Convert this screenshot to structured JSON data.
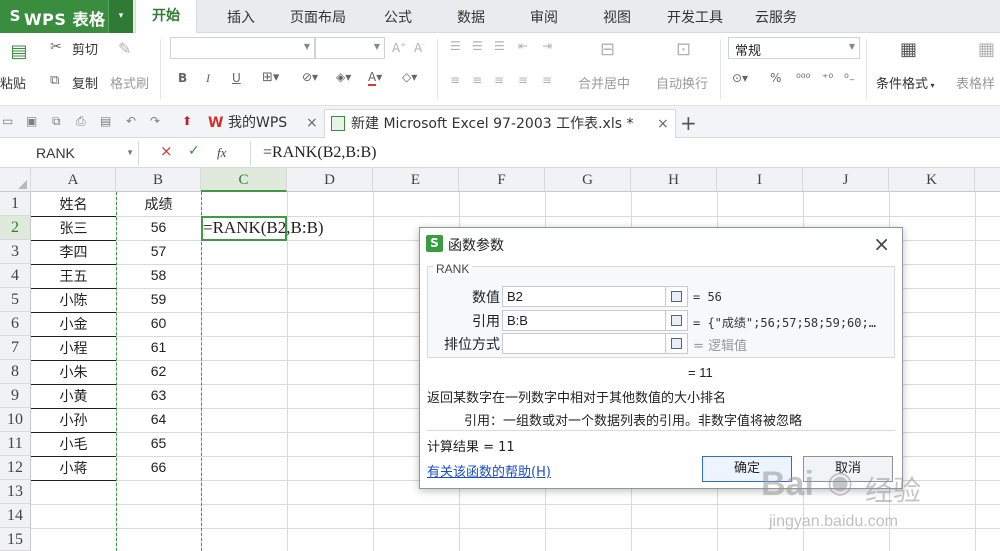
{
  "app": {
    "logo_letter": "S",
    "name": "WPS 表格",
    "menu_caret": "▾"
  },
  "menu_tabs": [
    "开始",
    "插入",
    "页面布局",
    "公式",
    "数据",
    "审阅",
    "视图",
    "开发工具",
    "云服务"
  ],
  "ribbon": {
    "paste": "粘贴",
    "cut": "剪切",
    "copy": "复制",
    "format_painter": "格式刷",
    "merge_center": "合并居中",
    "wrap_text": "自动换行",
    "number_format": "常规",
    "conditional_format": "条件格式",
    "table_style": "表格样"
  },
  "doc_tabs": [
    {
      "label": "我的WPS",
      "close": "×"
    },
    {
      "label": "新建 Microsoft Excel 97-2003 工作表.xls *",
      "close": "×"
    }
  ],
  "new_tab": "+",
  "formula_bar": {
    "name_box": "RANK",
    "cancel": "×",
    "confirm": "✓",
    "fx": "fx",
    "content": "=RANK(B2,B:B)"
  },
  "sheet": {
    "columns": [
      "A",
      "B",
      "C",
      "D",
      "E",
      "F",
      "G",
      "H",
      "I",
      "J",
      "K"
    ],
    "rows": [
      "1",
      "2",
      "3",
      "4",
      "5",
      "6",
      "7",
      "8",
      "9",
      "10",
      "11",
      "12",
      "13",
      "14",
      "15"
    ],
    "headers": {
      "name": "姓名",
      "score": "成绩"
    },
    "records": [
      {
        "name": "张三",
        "score": "56"
      },
      {
        "name": "李四",
        "score": "57"
      },
      {
        "name": "王五",
        "score": "58"
      },
      {
        "name": "小陈",
        "score": "59"
      },
      {
        "name": "小金",
        "score": "60"
      },
      {
        "name": "小程",
        "score": "61"
      },
      {
        "name": "小朱",
        "score": "62"
      },
      {
        "name": "小黄",
        "score": "63"
      },
      {
        "name": "小孙",
        "score": "64"
      },
      {
        "name": "小毛",
        "score": "65"
      },
      {
        "name": "小蒋",
        "score": "66"
      }
    ],
    "active_cell_text": "=RANK(B2,B:B)"
  },
  "dialog": {
    "icon": "S",
    "title": "函数参数",
    "close": "×",
    "function_name": "RANK",
    "params": [
      {
        "label": "数值",
        "value": "B2",
        "result": "= 56"
      },
      {
        "label": "引用",
        "value": "B:B",
        "result": "= {\"成绩\";56;57;58;59;60;…"
      },
      {
        "label": "排位方式",
        "value": "",
        "result": "= 逻辑值"
      }
    ],
    "function_result": "= 11",
    "description": "返回某数字在一列数字中相对于其他数值的大小排名",
    "param_description": "引用：一组数或对一个数据列表的引用。非数字值将被忽略",
    "calc_result": "计算结果 = 11",
    "help_link": "有关该函数的帮助(H)",
    "ok": "确定",
    "cancel": "取消"
  },
  "watermark": {
    "brand": "Bai",
    "brand2": "经验",
    "url": "jingyan.baidu.com"
  }
}
